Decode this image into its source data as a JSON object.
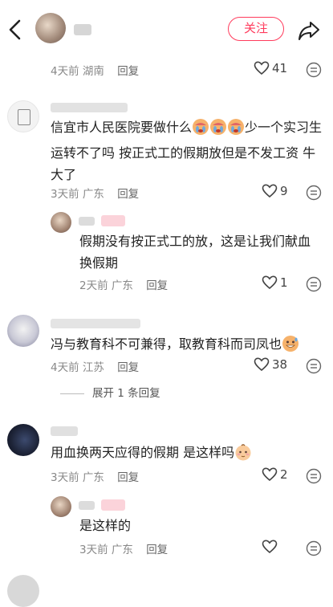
{
  "header": {
    "follow_label": "关注"
  },
  "comments": [
    {
      "meta": {
        "time": "4天前",
        "location": "湖南",
        "reply": "回复"
      },
      "likes": "41"
    },
    {
      "text_line1": "信宜市人民医院要做什么",
      "text_line1b": "少一个实习生",
      "text_line2": "运转不了吗 按正式工的假期放但是不发工资 牛",
      "text_line3": "大了",
      "meta": {
        "time": "3天前",
        "location": "广东",
        "reply": "回复"
      },
      "likes": "9",
      "emoji": "crying-face"
    },
    {
      "text_line1": "假期没有按正式工的放，这是让我们献血",
      "text_line2": "换假期",
      "meta": {
        "time": "2天前",
        "location": "广东",
        "reply": "回复"
      },
      "likes": "1"
    },
    {
      "text_line1": "冯与教育科不可兼得，取教育科而司凤也",
      "meta": {
        "time": "4天前",
        "location": "江苏",
        "reply": "回复"
      },
      "likes": "38",
      "expand_label": "展开 1 条回复",
      "emoji": "grinning-sweat-face"
    },
    {
      "text_line1": "用血换两天应得的假期  是这样吗",
      "meta": {
        "time": "3天前",
        "location": "广东",
        "reply": "回复"
      },
      "likes": "2",
      "emoji": "baby-face"
    },
    {
      "text_line1": "是这样的",
      "meta": {
        "time": "3天前",
        "location": "广东",
        "reply": "回复"
      },
      "likes": ""
    }
  ],
  "colors": {
    "accent": "#ff3b5c",
    "meta_gray": "#888888",
    "text": "#222222"
  }
}
